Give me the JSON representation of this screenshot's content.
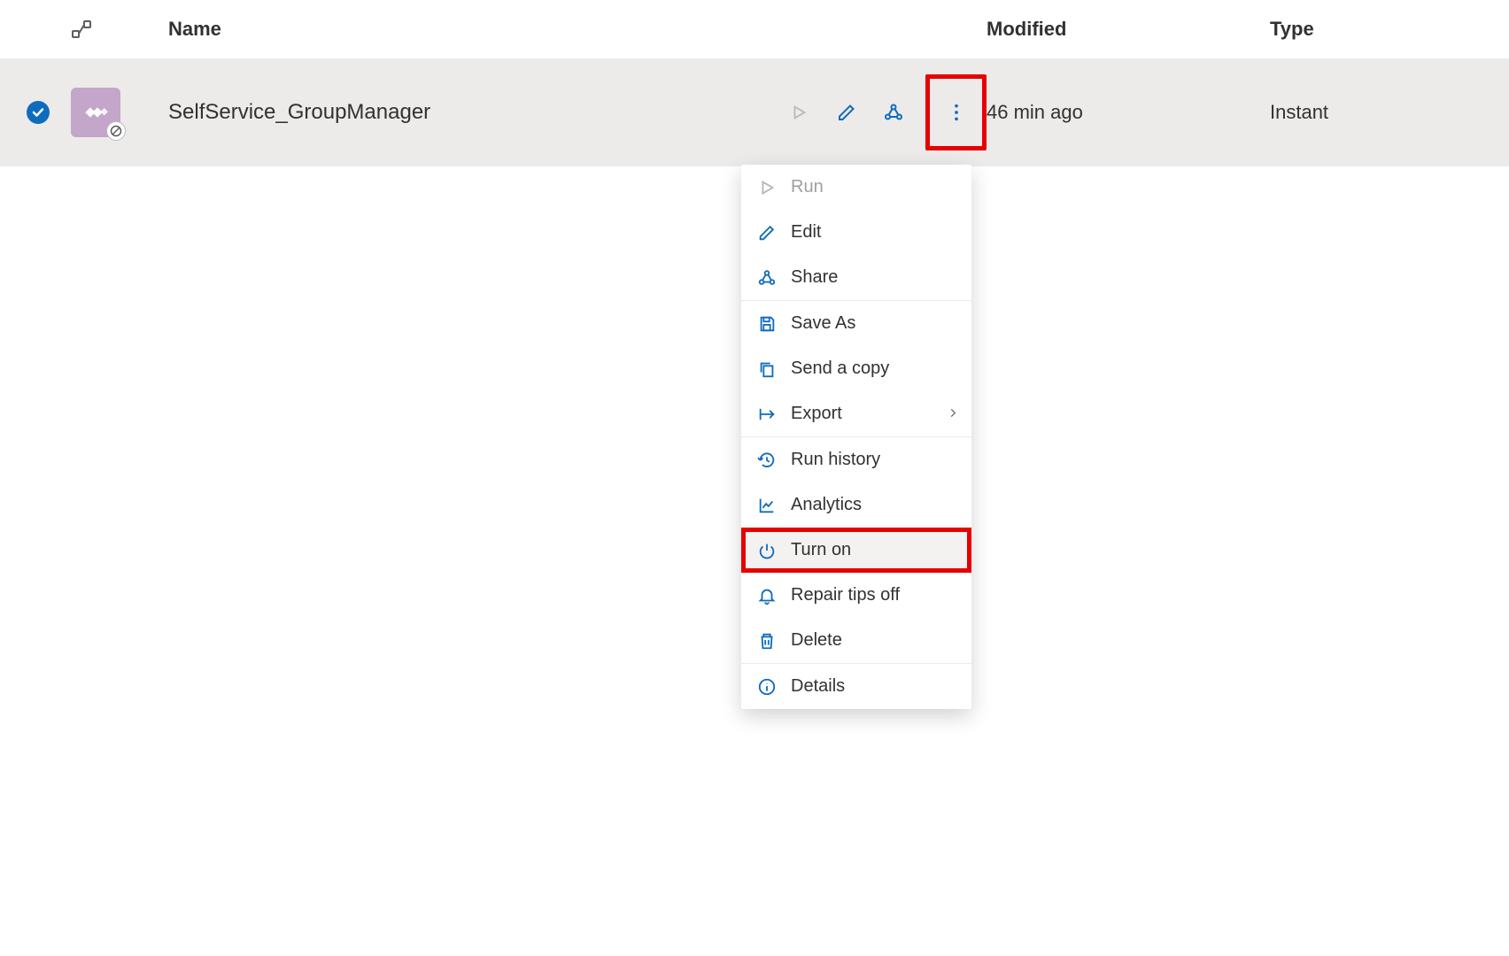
{
  "columns": {
    "name": "Name",
    "modified": "Modified",
    "type": "Type"
  },
  "row": {
    "name": "SelfService_GroupManager",
    "modified": "46 min ago",
    "type": "Instant"
  },
  "menu": {
    "run": "Run",
    "edit": "Edit",
    "share": "Share",
    "save_as": "Save As",
    "send_copy": "Send a copy",
    "export": "Export",
    "run_history": "Run history",
    "analytics": "Analytics",
    "turn_on": "Turn on",
    "repair_tips": "Repair tips off",
    "delete": "Delete",
    "details": "Details"
  }
}
